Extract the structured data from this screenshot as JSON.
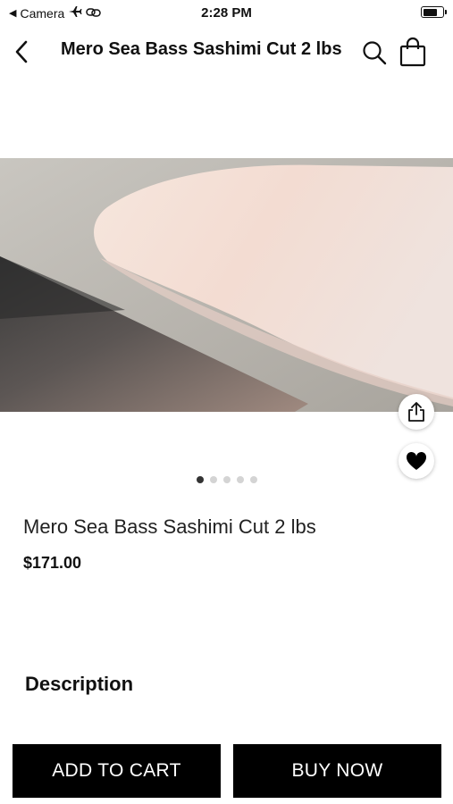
{
  "status_bar": {
    "back_app": "Camera",
    "time": "2:28 PM",
    "battery_level": 0.75
  },
  "nav": {
    "title": "Mero Sea Bass Sashimi Cut 2 lbs",
    "back_icon": "chevron-left-icon",
    "search_icon": "search-icon",
    "bag_icon": "shopping-bag-icon"
  },
  "gallery": {
    "image_count": 5,
    "active_index": 0,
    "share_icon": "share-icon",
    "favorite_icon": "heart-icon"
  },
  "product": {
    "name": "Mero Sea Bass Sashimi Cut 2 lbs",
    "price": "$171.00"
  },
  "sections": {
    "description_heading": "Description"
  },
  "actions": {
    "add_to_cart": "ADD TO CART",
    "buy_now": "BUY NOW"
  },
  "colors": {
    "button_bg": "#000000",
    "button_text": "#ffffff",
    "dot_active": "#333333",
    "dot_inactive": "#d4d4d4"
  }
}
